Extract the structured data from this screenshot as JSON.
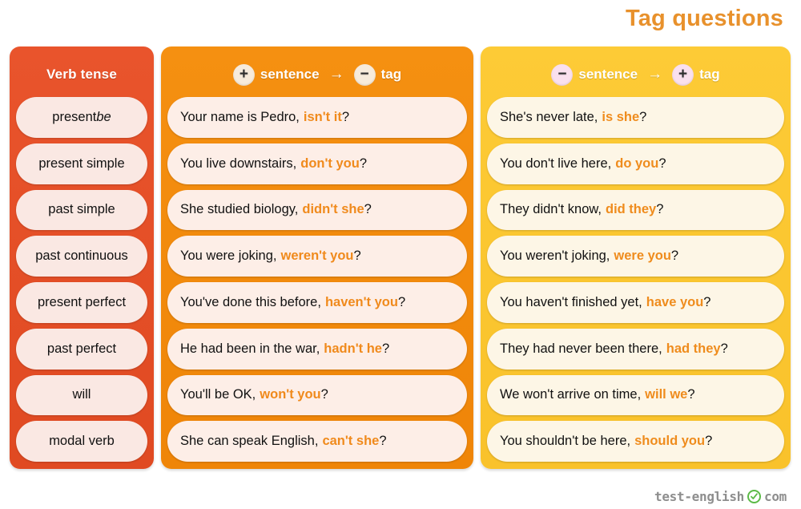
{
  "header": {
    "title": "Tag questions"
  },
  "columns": {
    "verb": {
      "header_label": "Verb tense",
      "items": [
        {
          "text": "present ",
          "italic_suffix": "be"
        },
        {
          "text": "present simple",
          "italic_suffix": ""
        },
        {
          "text": "past simple",
          "italic_suffix": ""
        },
        {
          "text": "past continuous",
          "italic_suffix": ""
        },
        {
          "text": "present perfect",
          "italic_suffix": ""
        },
        {
          "text": "past perfect",
          "italic_suffix": ""
        },
        {
          "text": "will",
          "italic_suffix": ""
        },
        {
          "text": "modal verb",
          "italic_suffix": ""
        }
      ]
    },
    "positive": {
      "header": {
        "sign_left": "+",
        "word_left": "sentence",
        "arrow": "→",
        "sign_right": "−",
        "word_right": "tag"
      },
      "rows": [
        {
          "statement": "Your name is Pedro,",
          "tag": "isn't it",
          "mark": "?"
        },
        {
          "statement": "You live downstairs,",
          "tag": "don't you",
          "mark": "?"
        },
        {
          "statement": "She studied biology,",
          "tag": "didn't she",
          "mark": "?"
        },
        {
          "statement": "You were joking,",
          "tag": "weren't you",
          "mark": "?"
        },
        {
          "statement": "You've done this before,",
          "tag": "haven't you",
          "mark": "?"
        },
        {
          "statement": "He had been in the war,",
          "tag": "hadn't he",
          "mark": "?"
        },
        {
          "statement": "You'll be OK,",
          "tag": "won't you",
          "mark": "?"
        },
        {
          "statement": "She can speak English,",
          "tag": "can't she",
          "mark": "?"
        }
      ]
    },
    "negative": {
      "header": {
        "sign_left": "−",
        "word_left": "sentence",
        "arrow": "→",
        "sign_right": "+",
        "word_right": "tag"
      },
      "rows": [
        {
          "statement": "She's never late,",
          "tag": "is she",
          "mark": "?"
        },
        {
          "statement": "You don't live here,",
          "tag": "do you",
          "mark": "?"
        },
        {
          "statement": "They didn't know,",
          "tag": "did they",
          "mark": "?"
        },
        {
          "statement": "You weren't joking,",
          "tag": "were you",
          "mark": "?"
        },
        {
          "statement": "You haven't finished yet,",
          "tag": "have you",
          "mark": "?"
        },
        {
          "statement": "They had never been there,",
          "tag": "had they",
          "mark": "?"
        },
        {
          "statement": "We won't arrive on time,",
          "tag": "will we",
          "mark": "?"
        },
        {
          "statement": "You shouldn't be here,",
          "tag": "should you",
          "mark": "?"
        }
      ]
    }
  },
  "footer": {
    "logo_left": "test-english",
    "logo_right": "com",
    "check_icon": "check-circle-icon"
  },
  "colors": {
    "title": "#e8912c",
    "verb_panel": "#e8512a",
    "positive_panel": "#f28c0f",
    "negative_panel": "#fbc731",
    "tag_text": "#f08a1c",
    "logo_gray": "#8e8e8e",
    "logo_green": "#5cba47"
  }
}
